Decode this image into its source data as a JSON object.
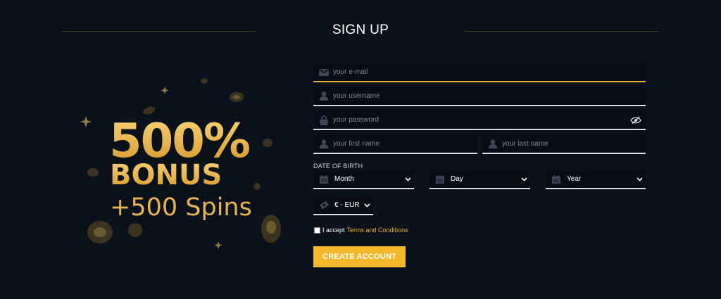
{
  "form": {
    "title": "SIGN UP",
    "email_placeholder": "your e-mail",
    "username_placeholder": "your username",
    "password_placeholder": "your password",
    "first_name_placeholder": "your first name",
    "last_name_placeholder": "your last name",
    "dob_label": "DATE OF BIRTH",
    "month": "Month",
    "day": "Day",
    "year": "Year",
    "currency": "€ - EUR",
    "accept_text": "I accept",
    "terms_link": "Terms and Conditions",
    "submit_label": "CREATE ACCOUNT"
  },
  "promo": {
    "line1": "500%",
    "line2": "BONUS",
    "line3": "+500 Spins"
  },
  "icons": {
    "email": "envelope-icon",
    "username": "user-icon",
    "password": "lock-icon",
    "show_password": "eye-slash-icon",
    "first_name": "user-icon",
    "last_name": "user-icon",
    "date": "calendar-icon",
    "currency": "money-icon",
    "dropdown": "chevron-down-icon"
  },
  "colors": {
    "background": "#0b111a",
    "field_background": "#080d15",
    "accent": "#f5b82a",
    "link": "#e9b52c",
    "focus_underline": "#e3b43a"
  }
}
